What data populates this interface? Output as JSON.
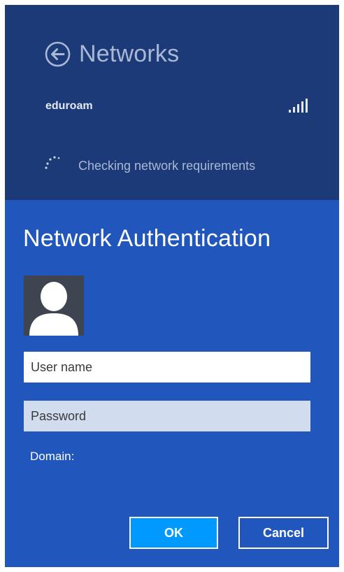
{
  "networks": {
    "title": "Networks",
    "back_icon": "back-arrow-circle-icon",
    "network": {
      "name": "eduroam",
      "signal_icon": "wifi-signal-bars-icon",
      "signal_level": 1.0
    },
    "status": {
      "text": "Checking network requirements",
      "icon": "progress-dots-icon"
    }
  },
  "auth": {
    "title": "Network Authentication",
    "avatar_icon": "user-avatar-icon",
    "username": {
      "placeholder": "User name",
      "value": ""
    },
    "password": {
      "placeholder": "Password",
      "value": ""
    },
    "domain_label": "Domain:",
    "ok_label": "OK",
    "cancel_label": "Cancel"
  },
  "colors": {
    "networks_bg": "#1c3a78",
    "auth_bg": "#2157bd",
    "ok_button_bg": "#0099ff",
    "password_bg": "#d2dcef",
    "dim_text": "#a9b8d4"
  }
}
